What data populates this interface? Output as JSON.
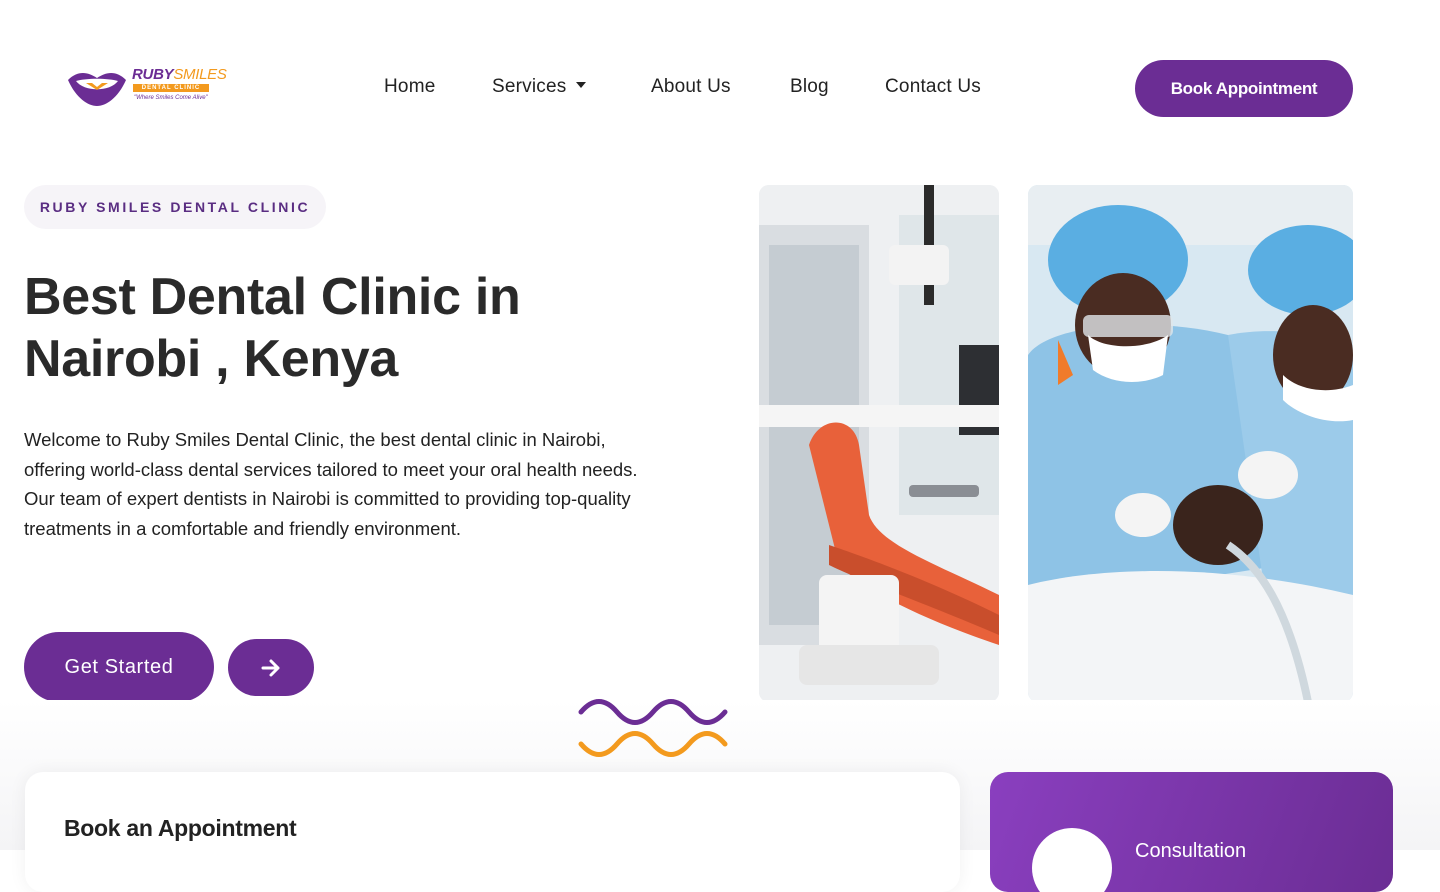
{
  "header": {
    "logo": {
      "brand_first": "RUBY",
      "brand_second": "SMILES",
      "subtitle": "DENTAL CLINIC",
      "tagline": "\"Where Smiles Come Alive\""
    },
    "nav": [
      {
        "label": "Home"
      },
      {
        "label": "Services",
        "has_dropdown": true
      },
      {
        "label": "About Us"
      },
      {
        "label": "Blog"
      },
      {
        "label": "Contact Us"
      }
    ],
    "cta_label": "Book Appointment"
  },
  "hero": {
    "eyebrow": "RUBY SMILES DENTAL CLINIC",
    "title_line1": "Best Dental Clinic in",
    "title_line2": "Nairobi , Kenya",
    "description": "Welcome to Ruby Smiles Dental Clinic, the best dental clinic in Nairobi, offering world-class dental services tailored to meet your oral health needs. Our team of expert dentists in Nairobi is committed to providing top-quality treatments in a comfortable and friendly environment.",
    "primary_button": "Get Started",
    "arrow_icon": "arrow-right-icon"
  },
  "booking": {
    "title": "Book an Appointment"
  },
  "consult": {
    "label": "Consultation"
  },
  "colors": {
    "brand_purple": "#6b2d94",
    "brand_orange": "#f39a1e",
    "text_dark": "#222222"
  }
}
